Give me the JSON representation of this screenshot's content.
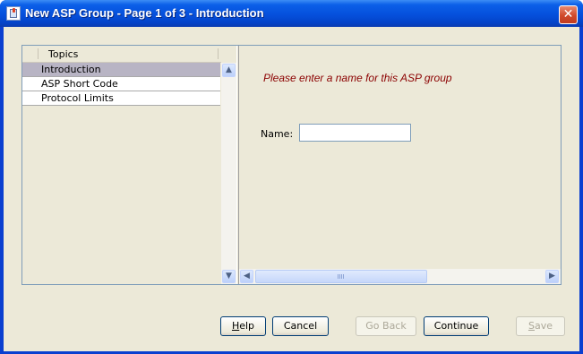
{
  "window": {
    "title": "New ASP Group - Page 1 of 3 - Introduction",
    "close_glyph": "✕"
  },
  "topics": {
    "header": "Topics",
    "items": [
      {
        "label": "Introduction",
        "selected": true
      },
      {
        "label": "ASP Short Code",
        "selected": false
      },
      {
        "label": "Protocol Limits",
        "selected": false
      }
    ]
  },
  "content": {
    "prompt": "Please enter a name for this ASP group",
    "name_label": "Name:",
    "name_value": ""
  },
  "scroll": {
    "up_glyph": "▲",
    "down_glyph": "▼",
    "left_glyph": "◀",
    "right_glyph": "▶"
  },
  "buttons": {
    "help_prefix": "",
    "help_mnemonic": "H",
    "help_rest": "elp",
    "cancel": "Cancel",
    "go_back": "Go Back",
    "continue": "Continue",
    "save_mnemonic": "S",
    "save_rest": "ave"
  },
  "colors": {
    "prompt_text": "#8b0000",
    "selected_row": "#b8b4c4",
    "titlebar": "#0550dc",
    "dialog_bg": "#ece9d8"
  }
}
